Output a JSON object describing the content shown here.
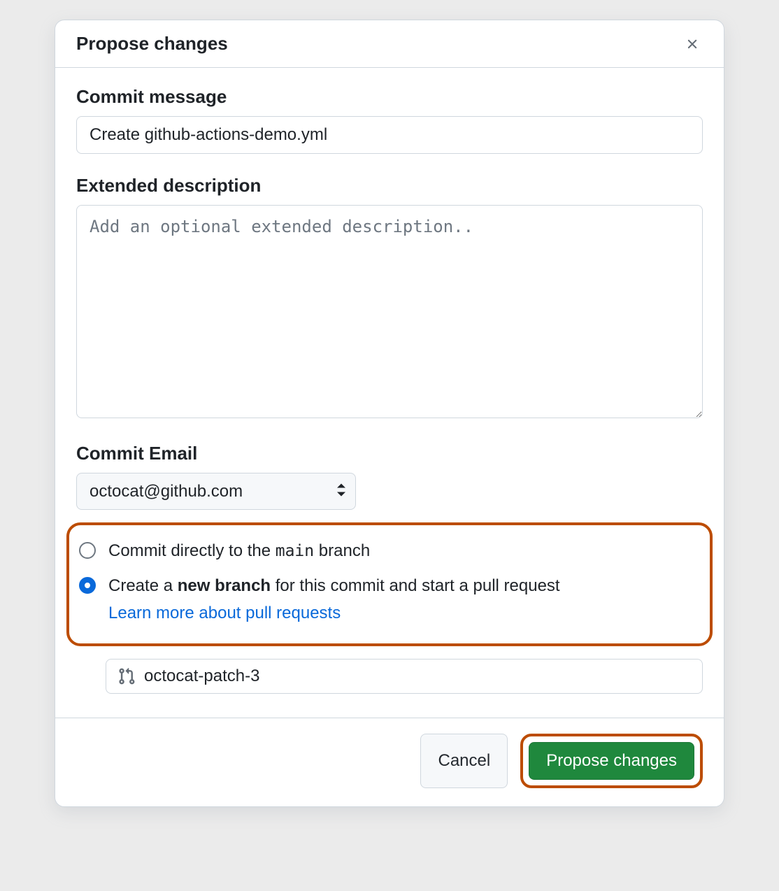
{
  "dialog": {
    "title": "Propose changes"
  },
  "commit_message": {
    "label": "Commit message",
    "value": "Create github-actions-demo.yml"
  },
  "extended_description": {
    "label": "Extended description",
    "placeholder": "Add an optional extended description.."
  },
  "commit_email": {
    "label": "Commit Email",
    "selected": "octocat@github.com"
  },
  "branch_choice": {
    "direct_prefix": "Commit directly to the ",
    "direct_branch": "main",
    "direct_suffix": " branch",
    "new_prefix": "Create a ",
    "new_bold": "new branch",
    "new_suffix": " for this commit and start a pull request",
    "learn_more": "Learn more about pull requests"
  },
  "branch_name": {
    "value": "octocat-patch-3"
  },
  "footer": {
    "cancel": "Cancel",
    "submit": "Propose changes"
  }
}
